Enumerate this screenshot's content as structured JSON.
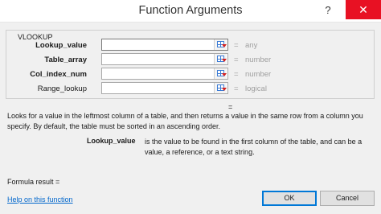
{
  "dialog": {
    "title": "Function Arguments",
    "help_glyph": "?",
    "close_glyph": "✕"
  },
  "function_group": {
    "name": "VLOOKUP",
    "arguments": [
      {
        "label": "Lookup_value",
        "bold": true,
        "value": "",
        "equals": "=",
        "hint": "any"
      },
      {
        "label": "Table_array",
        "bold": true,
        "value": "",
        "equals": "=",
        "hint": "number"
      },
      {
        "label": "Col_index_num",
        "bold": true,
        "value": "",
        "equals": "=",
        "hint": "number"
      },
      {
        "label": "Range_lookup",
        "bold": false,
        "value": "",
        "equals": "=",
        "hint": "logical"
      }
    ]
  },
  "result_equals": "=",
  "description": "Looks for a value in the leftmost column of a table, and then returns a value in the same row from a column you specify. By default, the table must be sorted in an ascending order.",
  "argument_help": {
    "name": "Lookup_value",
    "text": "is the value to be found in the first column of the table, and can be a value, a reference, or a text string."
  },
  "formula_result_label": "Formula result =",
  "help_link": "Help on this function",
  "buttons": {
    "ok": "OK",
    "cancel": "Cancel"
  },
  "icons": {
    "collapse": "range-collapse-icon"
  }
}
